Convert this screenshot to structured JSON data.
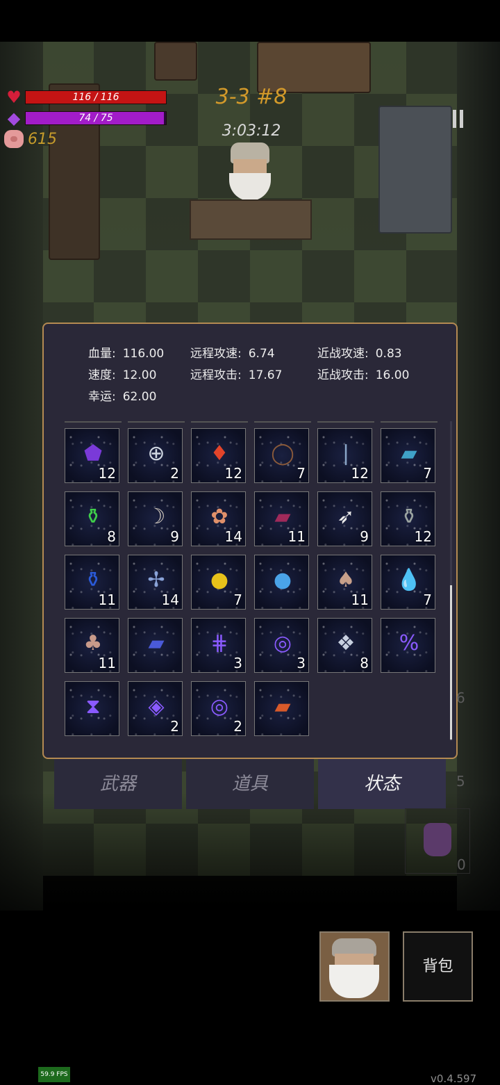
{
  "hud": {
    "hp_text": "116 / 116",
    "hp_fraction": 1.0,
    "mp_text": "74 / 75",
    "mp_fraction": 0.987,
    "gold": "615",
    "level": "3-3 #8",
    "timer": "3:03:12",
    "heart_icon": "♥",
    "mana_icon": "◆"
  },
  "stats": [
    {
      "key": "血量:",
      "value": "116.00"
    },
    {
      "key": "远程攻速:",
      "value": "6.74"
    },
    {
      "key": "近战攻速:",
      "value": "0.83"
    },
    {
      "key": "速度:",
      "value": "12.00"
    },
    {
      "key": "远程攻击:",
      "value": "17.67"
    },
    {
      "key": "近战攻击:",
      "value": "16.00"
    },
    {
      "key": "幸运:",
      "value": "62.00"
    }
  ],
  "items": [
    {
      "icon": "purple-gem-icon",
      "glyph": "⬟",
      "color": "#7a3ad8",
      "count": "12"
    },
    {
      "icon": "silver-ring-icon",
      "glyph": "⊕",
      "color": "#cfd6e0",
      "count": "2"
    },
    {
      "icon": "red-crystal-icon",
      "glyph": "♦",
      "color": "#e3442a",
      "count": "12"
    },
    {
      "icon": "thorn-wreath-icon",
      "glyph": "◯",
      "color": "#8a5a3a",
      "count": "7"
    },
    {
      "icon": "glass-vial-icon",
      "glyph": "❘",
      "color": "#8aa6c8",
      "count": "12"
    },
    {
      "icon": "blue-book-icon",
      "glyph": "▰",
      "color": "#3fa2c8",
      "count": "7"
    },
    {
      "icon": "green-potion-icon",
      "glyph": "⚱",
      "color": "#3fcf4a",
      "count": "8"
    },
    {
      "icon": "horn-icon",
      "glyph": "☽",
      "color": "#d8cfc2",
      "count": "9"
    },
    {
      "icon": "fish-icon",
      "glyph": "✿",
      "color": "#e0906a",
      "count": "14"
    },
    {
      "icon": "red-spellbook-icon",
      "glyph": "▰",
      "color": "#a02a5a",
      "count": "11"
    },
    {
      "icon": "feather-icon",
      "glyph": "➶",
      "color": "#eaeaea",
      "count": "9"
    },
    {
      "icon": "gray-potion-icon",
      "glyph": "⚱",
      "color": "#9aa3a0",
      "count": "12"
    },
    {
      "icon": "blue-potion-icon",
      "glyph": "⚱",
      "color": "#2a5ad8",
      "count": "11"
    },
    {
      "icon": "dragonfly-icon",
      "glyph": "✢",
      "color": "#8aa3d8",
      "count": "14"
    },
    {
      "icon": "gold-coin-icon",
      "glyph": "●",
      "color": "#e8c21a",
      "count": "7"
    },
    {
      "icon": "blue-orb-icon",
      "glyph": "●",
      "color": "#4aa3e8",
      "count": ""
    },
    {
      "icon": "pouch-icon",
      "glyph": "♠",
      "color": "#c8a08a",
      "count": "11"
    },
    {
      "icon": "water-drop-icon",
      "glyph": "💧",
      "color": "#2a8ae0",
      "count": "7"
    },
    {
      "icon": "mushroom-icon",
      "glyph": "♣",
      "color": "#c89a8a",
      "count": "11"
    },
    {
      "icon": "tome-icon",
      "glyph": "▰",
      "color": "#4a5ad8",
      "count": ""
    },
    {
      "icon": "rune-icon",
      "glyph": "⋕",
      "color": "#8a5aff",
      "count": "3"
    },
    {
      "icon": "spiral-rune-icon",
      "glyph": "◎",
      "color": "#8a5aff",
      "count": "3"
    },
    {
      "icon": "steel-cube-icon",
      "glyph": "❖",
      "color": "#c8d0e0",
      "count": "8"
    },
    {
      "icon": "percent-rune-icon",
      "glyph": "%",
      "color": "#8a5aff",
      "count": ""
    },
    {
      "icon": "hourglass-rune-icon",
      "glyph": "⧗",
      "color": "#8a5aff",
      "count": ""
    },
    {
      "icon": "eye-rune-icon",
      "glyph": "◈",
      "color": "#8a5aff",
      "count": "2"
    },
    {
      "icon": "swirl-rune-icon",
      "glyph": "◎",
      "color": "#8a5aff",
      "count": "2"
    },
    {
      "icon": "fire-book-icon",
      "glyph": "▰",
      "color": "#d85a2a",
      "count": ""
    }
  ],
  "tabs": [
    {
      "label": "武器",
      "active": false
    },
    {
      "label": "道具",
      "active": false
    },
    {
      "label": "状态",
      "active": true
    }
  ],
  "side": {
    "num_a": "6",
    "num_b": "5",
    "potion_count": "0"
  },
  "bag_label": "背包",
  "fps": "59.9 FPS",
  "version": "v0.4.597",
  "colors": {
    "accent": "#b48a52",
    "hp": "#c41414",
    "mp": "#a21cc8",
    "gold": "#c69c2b",
    "level": "#d49a2a"
  }
}
